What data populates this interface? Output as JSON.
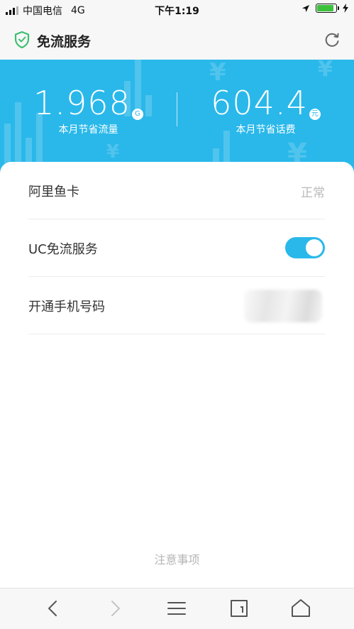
{
  "status_bar": {
    "carrier": "中国电信",
    "network": "4G",
    "time": "下午1:19",
    "battery_level": 0.9
  },
  "header": {
    "title": "免流服务",
    "icons": [
      "shield-icon",
      "refresh-icon"
    ]
  },
  "summary": {
    "data_saved": {
      "value": "1.968",
      "unit": "G",
      "label": "本月节省流量"
    },
    "fee_saved": {
      "value": "604.4",
      "unit": "元",
      "label": "本月节省话费"
    }
  },
  "rows": [
    {
      "label": "阿里鱼卡",
      "value": "正常"
    },
    {
      "label": "UC免流服务",
      "toggle_on": true
    },
    {
      "label": "开通手机号码"
    }
  ],
  "notice": "注意事项",
  "bottom_nav": {
    "icons": [
      "back-icon",
      "forward-icon",
      "menu-icon",
      "tabs-icon",
      "home-icon"
    ]
  },
  "colors": {
    "accent": "#2ab8ea",
    "shield": "#3cbf6f",
    "battery": "#3cc13b"
  }
}
